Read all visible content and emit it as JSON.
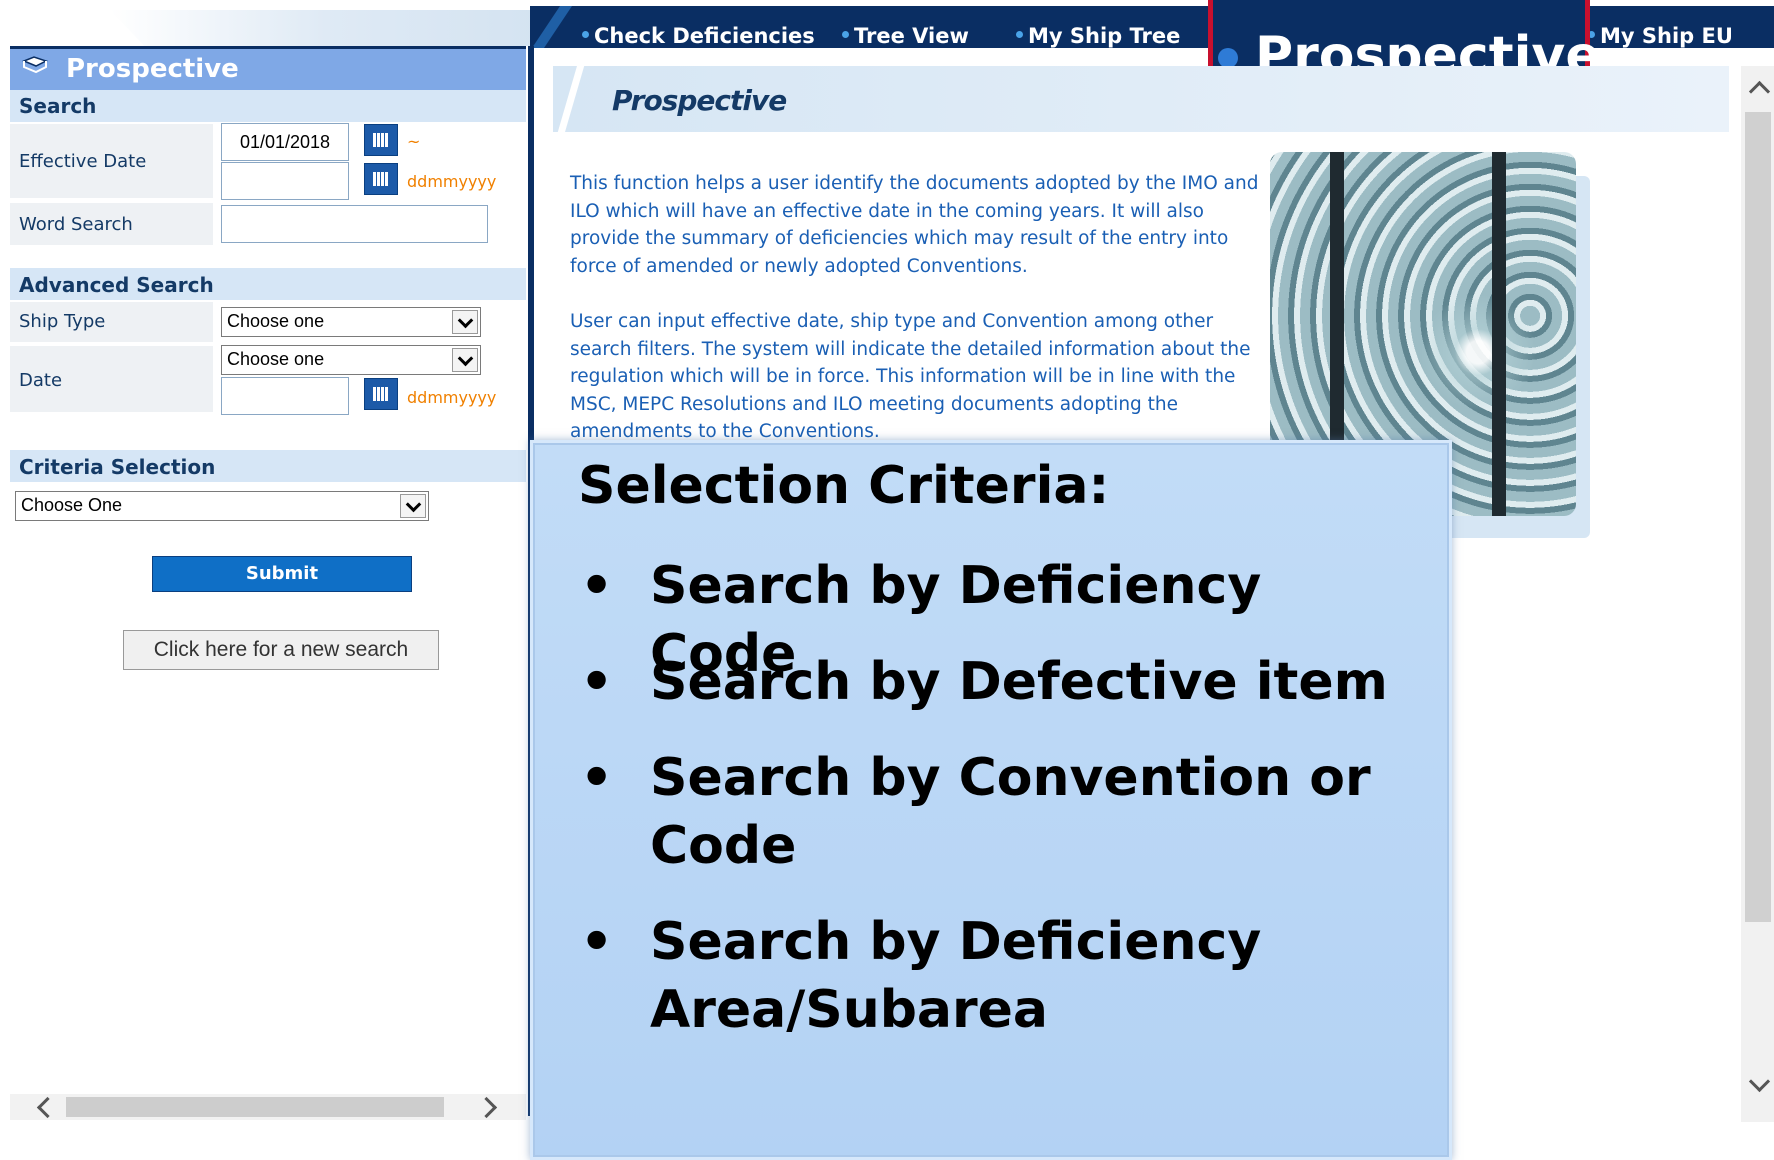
{
  "nav": {
    "items": [
      "Check Deficiencies",
      "Tree View",
      "My Ship Tree",
      "My Ship EU"
    ],
    "callout": "Prospective"
  },
  "left_panel": {
    "title": "Prospective",
    "search_section": "Search",
    "effective_date_label": "Effective Date",
    "effective_date_from": "01/01/2018",
    "effective_date_to": "",
    "range_tilde": "~",
    "date_format": "ddmmyyyy",
    "word_search_label": "Word Search",
    "word_search_value": "",
    "advanced_section": "Advanced Search",
    "ship_type_label": "Ship Type",
    "ship_type_value": "Choose one",
    "date_label": "Date",
    "date_select_value": "Choose one",
    "date_value": "",
    "criteria_section": "Criteria Selection",
    "criteria_value": "Choose One",
    "submit_label": "Submit",
    "new_search_label": "Click here for a new search"
  },
  "content": {
    "title": "Prospective",
    "paragraph1": "This function helps a user identify the documents adopted by the IMO and ILO which will have an effective date in the coming years. It will also provide the summary of deficiencies which may result of the entry into force of amended or newly adopted Conventions.",
    "paragraph2": "User can input effective date, ship type and Convention among other search filters. The system will indicate the detailed information about the regulation which will be in force. This information will be in line with the MSC, MEPC Resolutions and ILO meeting documents adopting the amendments to the Conventions."
  },
  "overlay": {
    "title": "Selection Criteria:",
    "bullet_glyph": "•",
    "items": [
      "Search by Deficiency Code",
      "Search by Defective item",
      "Search by Convention or Code",
      "Search by Deficiency Area/Subarea"
    ]
  },
  "colors": {
    "nav_bg": "#0a2e63",
    "callout_border": "#c8102e",
    "accent_blue": "#0f6fc6",
    "overlay_bg": "#c2dcf7",
    "text_blue": "#1a5fb4",
    "date_format_orange": "#f08000"
  }
}
